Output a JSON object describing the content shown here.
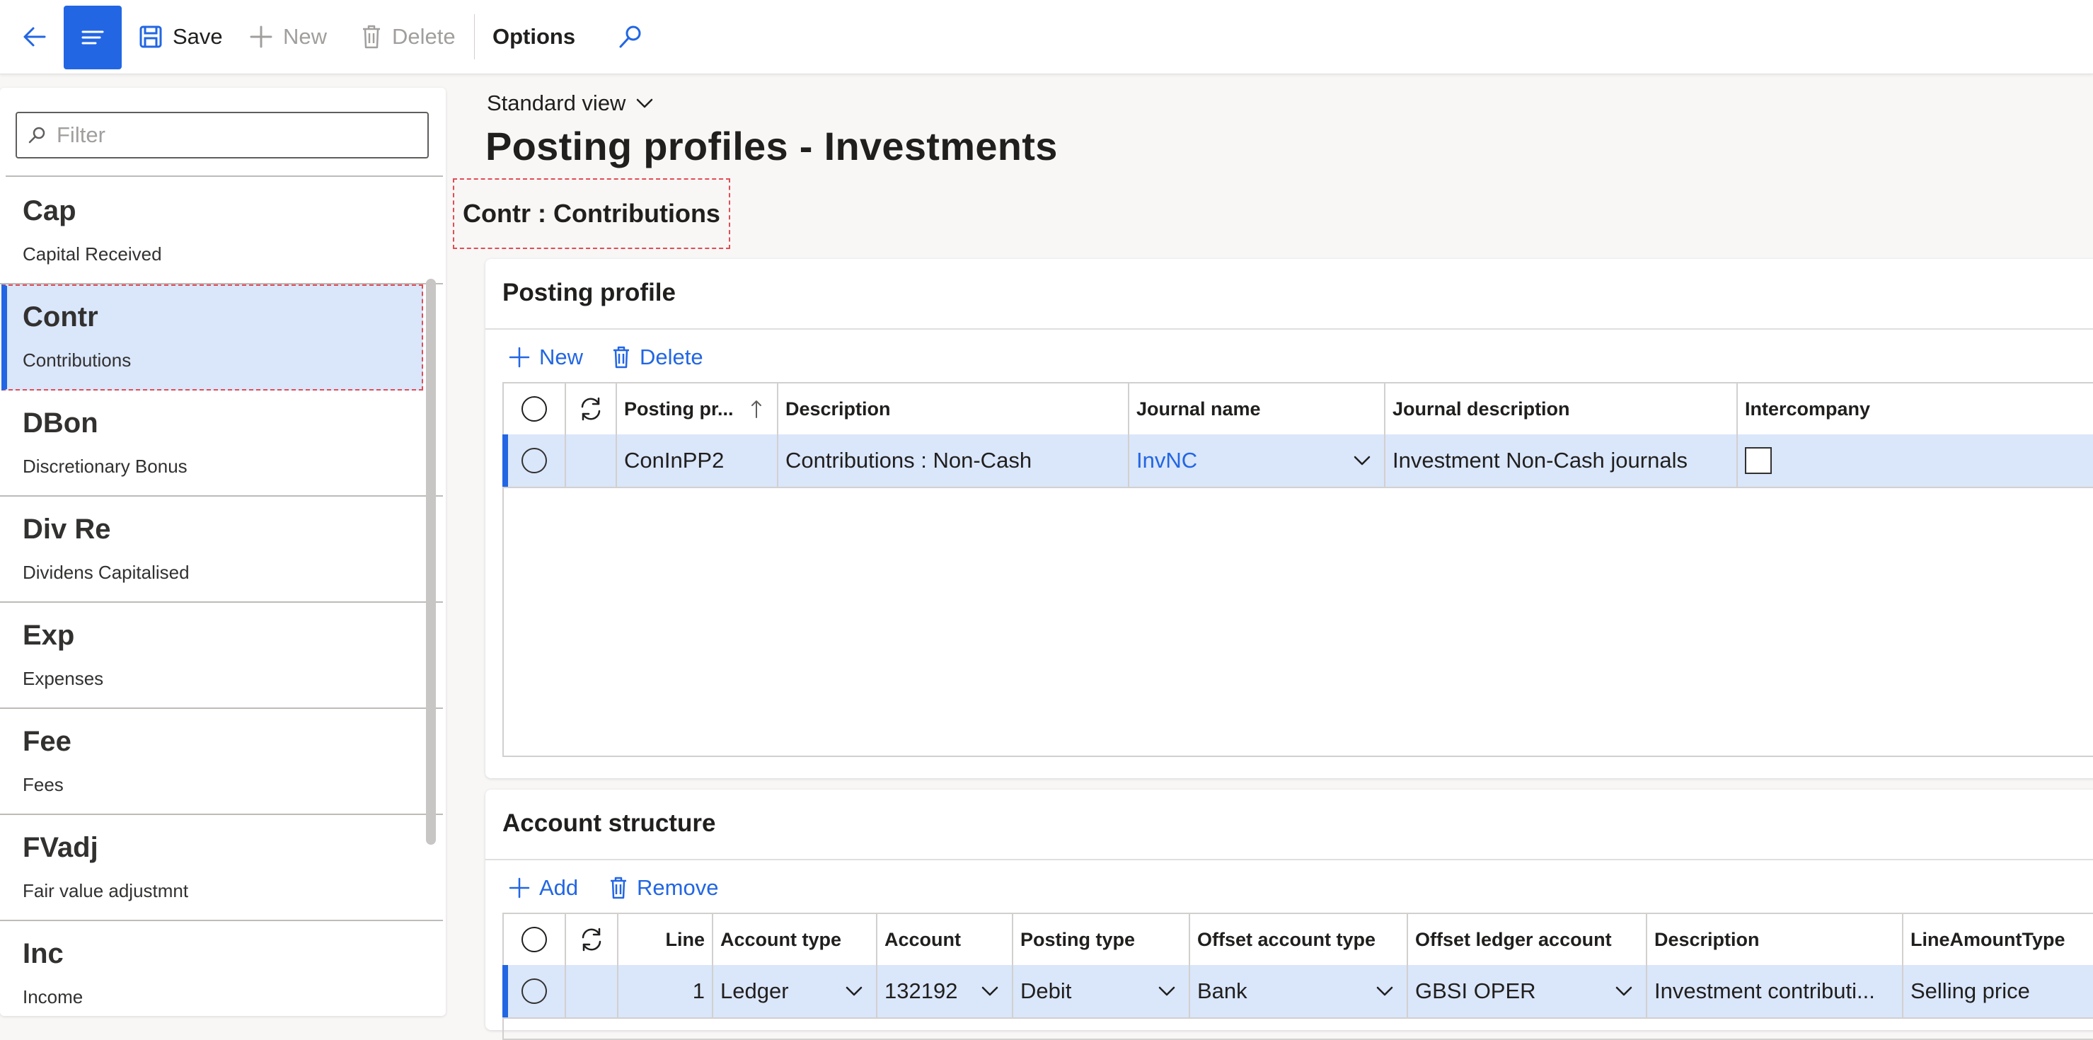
{
  "toolbar": {
    "save_label": "Save",
    "new_label": "New",
    "delete_label": "Delete",
    "options_label": "Options"
  },
  "filter": {
    "placeholder": "Filter"
  },
  "list": {
    "items": [
      {
        "code": "Cap",
        "description": "Capital Received",
        "selected": false
      },
      {
        "code": "Contr",
        "description": "Contributions",
        "selected": true
      },
      {
        "code": "DBon",
        "description": "Discretionary Bonus",
        "selected": false
      },
      {
        "code": "Div Re",
        "description": "Dividens Capitalised",
        "selected": false
      },
      {
        "code": "Exp",
        "description": "Expenses",
        "selected": false
      },
      {
        "code": "Fee",
        "description": "Fees",
        "selected": false
      },
      {
        "code": "FVadj",
        "description": "Fair value adjustmnt",
        "selected": false
      },
      {
        "code": "Inc",
        "description": "Income",
        "selected": false
      }
    ]
  },
  "page": {
    "view_label": "Standard view",
    "title": "Posting profiles - Investments",
    "record_heading": "Contr : Contributions"
  },
  "posting_profile": {
    "title": "Posting profile",
    "new_label": "New",
    "delete_label": "Delete",
    "columns": [
      "Posting pr...",
      "Description",
      "Journal name",
      "Journal description",
      "Intercompany"
    ],
    "rows": [
      {
        "posting_profile": "ConInPP2",
        "description": "Contributions : Non-Cash",
        "journal_name": "InvNC",
        "journal_description": "Investment Non-Cash journals",
        "intercompany": false
      }
    ]
  },
  "account_structure": {
    "title": "Account structure",
    "add_label": "Add",
    "remove_label": "Remove",
    "columns": [
      "Line",
      "Account type",
      "Account",
      "Posting type",
      "Offset account type",
      "Offset ledger account",
      "Description",
      "LineAmountType"
    ],
    "rows": [
      {
        "line": "1",
        "account_type": "Ledger",
        "account": "132192",
        "posting_type": "Debit",
        "offset_account_type": "Bank",
        "offset_ledger_account": "GBSI OPER",
        "description": "Investment contributi...",
        "line_amount_type": "Selling price"
      }
    ]
  },
  "colors": {
    "accent": "#2266e3",
    "selected_row": "#dae6fa",
    "highlight_border": "#e14c55"
  }
}
